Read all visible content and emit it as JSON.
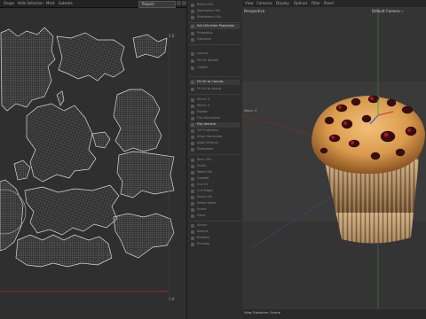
{
  "topbar": {
    "menus": [
      "Snaps",
      "Hide Selection",
      "Mark",
      "Subsets"
    ],
    "uv_set_value": "Project"
  },
  "uv_editor": {
    "corner_top": "1.0",
    "corner_bottom": "1.0"
  },
  "tools": {
    "items": [
      {
        "label": "Relax UVs"
      },
      {
        "label": "Normalize UVs"
      },
      {
        "label": "Straighten UVs"
      },
      {
        "label": "Set UVs from Projection",
        "highlight": true
      },
      {
        "label": "Projection"
      },
      {
        "label": "Optimize"
      },
      {
        "label": "Layout"
      },
      {
        "label": "Fit UV Islands"
      },
      {
        "label": "Unfold"
      },
      {
        "label": "Fit UV to Canvas",
        "highlight": true
      },
      {
        "label": "Fit UV to Island"
      },
      {
        "label": "Mirror U"
      },
      {
        "label": "Mirror V"
      },
      {
        "label": "Rotate"
      },
      {
        "label": "Flip Horizontal"
      },
      {
        "label": "Flip Vertical"
      },
      {
        "label": "UV Projection"
      },
      {
        "label": "Align Horizontal"
      },
      {
        "label": "Align Vertical"
      },
      {
        "label": "Straighten"
      },
      {
        "label": "Pack UVs"
      },
      {
        "label": "Stitch"
      },
      {
        "label": "Weld UVs"
      },
      {
        "label": "Unweld"
      },
      {
        "label": "Cut UV"
      },
      {
        "label": "Cut Edges"
      },
      {
        "label": "Select All"
      },
      {
        "label": "Select None"
      },
      {
        "label": "Invert"
      },
      {
        "label": "Grow"
      },
      {
        "label": "Shrink"
      },
      {
        "label": "Islands"
      },
      {
        "label": "Borders"
      },
      {
        "label": "Preview"
      }
    ]
  },
  "viewport": {
    "menus": [
      "View",
      "Cameras",
      "Display",
      "Options",
      "Filter",
      "Panel"
    ],
    "perspective_label": "Perspective",
    "camera_label": "Default Camera ⌐",
    "move_label": "Move: X",
    "status_text": "View Transform: Scene"
  }
}
